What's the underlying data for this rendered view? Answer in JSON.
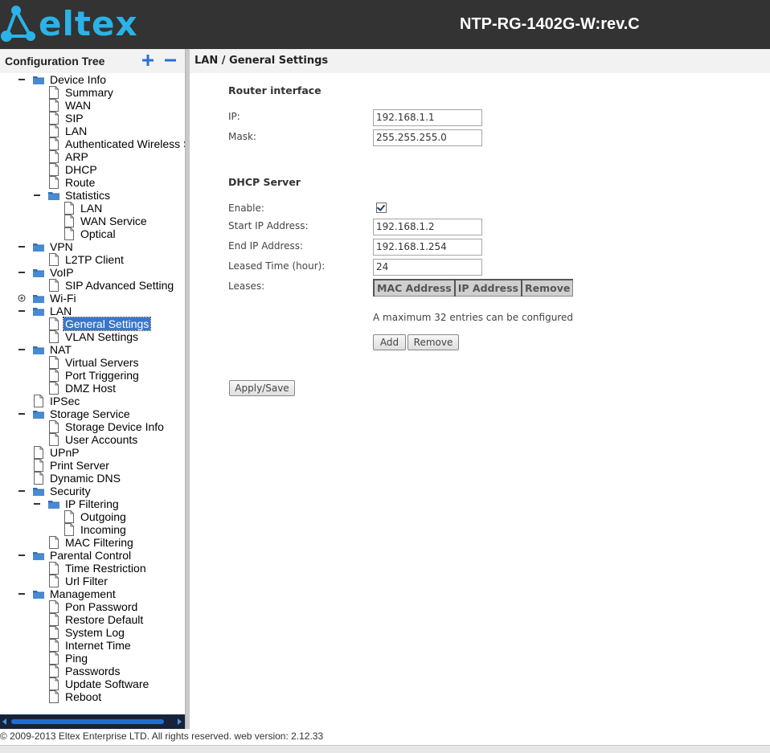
{
  "header": {
    "brand": "eltex",
    "model": "NTP-RG-1402G-W:rev.C",
    "brand_color": "#2ab3e8",
    "background": "#333333"
  },
  "tree": {
    "title": "Configuration Tree",
    "expand_all_icon": "plus-icon",
    "collapse_all_icon": "minus-icon",
    "items": [
      {
        "label": "Device Info",
        "level": 0,
        "type": "folder",
        "toggle": "minus"
      },
      {
        "label": "Summary",
        "level": 1,
        "type": "page"
      },
      {
        "label": "WAN",
        "level": 1,
        "type": "page"
      },
      {
        "label": "SIP",
        "level": 1,
        "type": "page"
      },
      {
        "label": "LAN",
        "level": 1,
        "type": "page"
      },
      {
        "label": "Authenticated Wireless Statio",
        "level": 1,
        "type": "page"
      },
      {
        "label": "ARP",
        "level": 1,
        "type": "page"
      },
      {
        "label": "DHCP",
        "level": 1,
        "type": "page"
      },
      {
        "label": "Route",
        "level": 1,
        "type": "page"
      },
      {
        "label": "Statistics",
        "level": 1,
        "type": "folder",
        "toggle": "minus"
      },
      {
        "label": "LAN",
        "level": 2,
        "type": "page"
      },
      {
        "label": "WAN Service",
        "level": 2,
        "type": "page"
      },
      {
        "label": "Optical",
        "level": 2,
        "type": "page"
      },
      {
        "label": "VPN",
        "level": 0,
        "type": "folder",
        "toggle": "minus"
      },
      {
        "label": "L2TP Client",
        "level": 1,
        "type": "page"
      },
      {
        "label": "VoIP",
        "level": 0,
        "type": "folder",
        "toggle": "minus"
      },
      {
        "label": "SIP Advanced Setting",
        "level": 1,
        "type": "page"
      },
      {
        "label": "Wi-Fi",
        "level": 0,
        "type": "folder",
        "toggle": "plus"
      },
      {
        "label": "LAN",
        "level": 0,
        "type": "folder",
        "toggle": "minus"
      },
      {
        "label": "General Settings",
        "level": 1,
        "type": "page",
        "selected": true
      },
      {
        "label": "VLAN Settings",
        "level": 1,
        "type": "page"
      },
      {
        "label": "NAT",
        "level": 0,
        "type": "folder",
        "toggle": "minus"
      },
      {
        "label": "Virtual Servers",
        "level": 1,
        "type": "page"
      },
      {
        "label": "Port Triggering",
        "level": 1,
        "type": "page"
      },
      {
        "label": "DMZ Host",
        "level": 1,
        "type": "page"
      },
      {
        "label": "IPSec",
        "level": 0,
        "type": "page"
      },
      {
        "label": "Storage Service",
        "level": 0,
        "type": "folder",
        "toggle": "minus"
      },
      {
        "label": "Storage Device Info",
        "level": 1,
        "type": "page"
      },
      {
        "label": "User Accounts",
        "level": 1,
        "type": "page"
      },
      {
        "label": "UPnP",
        "level": 0,
        "type": "page"
      },
      {
        "label": "Print Server",
        "level": 0,
        "type": "page"
      },
      {
        "label": "Dynamic DNS",
        "level": 0,
        "type": "page"
      },
      {
        "label": "Security",
        "level": 0,
        "type": "folder",
        "toggle": "minus"
      },
      {
        "label": "IP Filtering",
        "level": 1,
        "type": "folder",
        "toggle": "minus"
      },
      {
        "label": "Outgoing",
        "level": 2,
        "type": "page"
      },
      {
        "label": "Incoming",
        "level": 2,
        "type": "page"
      },
      {
        "label": "MAC Filtering",
        "level": 1,
        "type": "page"
      },
      {
        "label": "Parental Control",
        "level": 0,
        "type": "folder",
        "toggle": "minus"
      },
      {
        "label": "Time Restriction",
        "level": 1,
        "type": "page"
      },
      {
        "label": "Url Filter",
        "level": 1,
        "type": "page"
      },
      {
        "label": "Management",
        "level": 0,
        "type": "folder",
        "toggle": "minus"
      },
      {
        "label": "Pon Password",
        "level": 1,
        "type": "page"
      },
      {
        "label": "Restore Default",
        "level": 1,
        "type": "page"
      },
      {
        "label": "System Log",
        "level": 1,
        "type": "page"
      },
      {
        "label": "Internet Time",
        "level": 1,
        "type": "page"
      },
      {
        "label": "Ping",
        "level": 1,
        "type": "page"
      },
      {
        "label": "Passwords",
        "level": 1,
        "type": "page"
      },
      {
        "label": "Update Software",
        "level": 1,
        "type": "page"
      },
      {
        "label": "Reboot",
        "level": 1,
        "type": "page"
      }
    ]
  },
  "content": {
    "title": "LAN / General Settings",
    "router": {
      "section": "Router interface",
      "ip_label": "IP:",
      "ip_value": "192.168.1.1",
      "mask_label": "Mask:",
      "mask_value": "255.255.255.0"
    },
    "dhcp": {
      "section": "DHCP Server",
      "enable_label": "Enable:",
      "enable_checked": true,
      "start_label": "Start IP Address:",
      "start_value": "192.168.1.2",
      "end_label": "End IP Address:",
      "end_value": "192.168.1.254",
      "lease_label": "Leased Time (hour):",
      "lease_value": "24",
      "leases_label": "Leases:",
      "columns": [
        "MAC Address",
        "IP Address",
        "Remove"
      ],
      "note": "A maximum 32 entries can be configured",
      "add_label": "Add",
      "remove_label": "Remove"
    },
    "apply_label": "Apply/Save"
  },
  "footer": {
    "text": "© 2009-2013 Eltex Enterprise LTD. All rights reserved. web version: 2.12.33"
  }
}
